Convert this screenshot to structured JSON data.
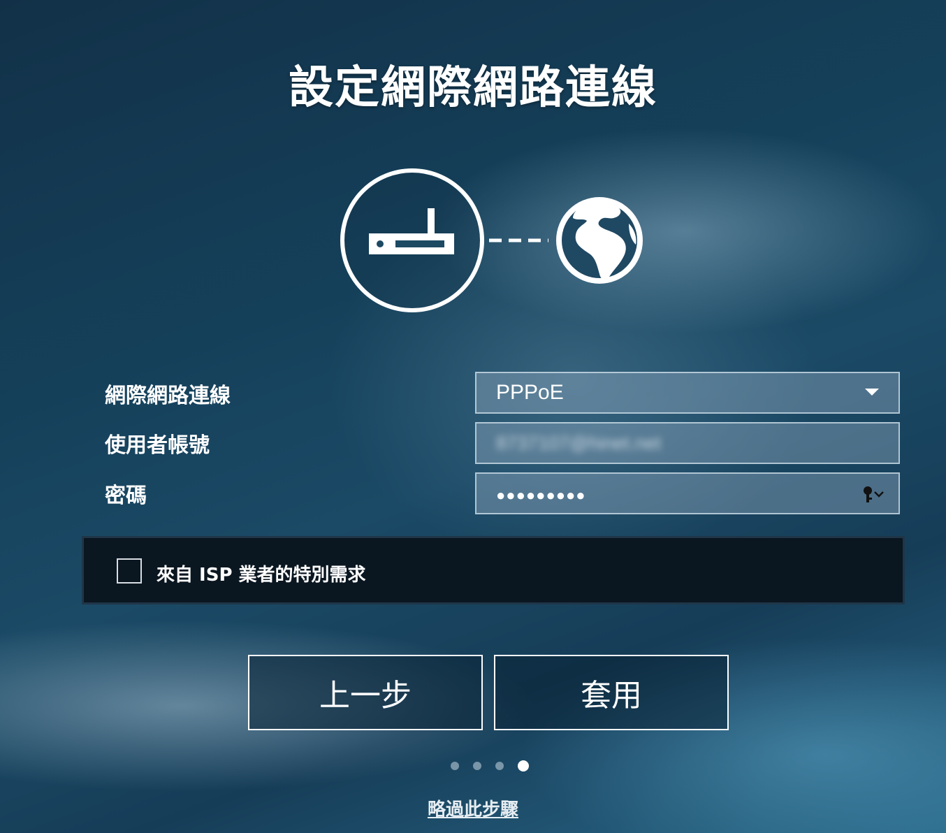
{
  "page": {
    "title": "設定網際網路連線"
  },
  "form": {
    "connection": {
      "label": "網際網路連線",
      "value": "PPPoE"
    },
    "username": {
      "label": "使用者帳號",
      "value": "8737107@hinet.net"
    },
    "password": {
      "label": "密碼",
      "value": "●●●●●●●●●"
    },
    "isp_special": {
      "label": "來自 ISP 業者的特別需求",
      "checked": false
    }
  },
  "buttons": {
    "back": "上一步",
    "apply": "套用"
  },
  "pager": {
    "total": 4,
    "active": 4
  },
  "skip_link": "略過此步驟",
  "icons": {
    "router": "router-icon",
    "globe": "globe-icon",
    "dropdown": "chevron-down-icon",
    "password_key": "key-icon"
  }
}
